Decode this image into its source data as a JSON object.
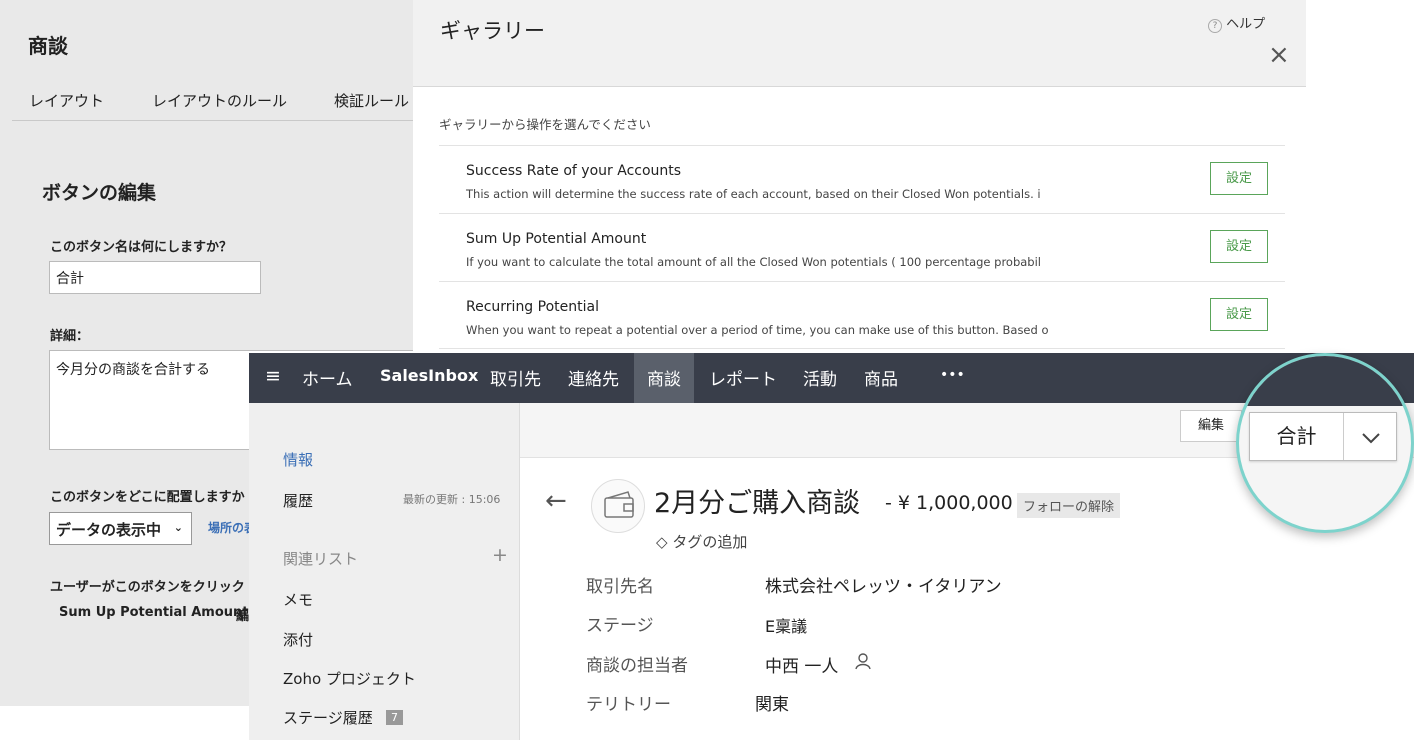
{
  "back_panel": {
    "module_title": "商談",
    "tabs": [
      "レイアウト",
      "レイアウトのルール",
      "検証ルール"
    ],
    "edit_title": "ボタンの編集",
    "name_question": "このボタン名は何にしますか？",
    "name_value": "合計",
    "detail_label": "詳細：",
    "detail_value": "今月分の商談を合計する",
    "place_question": "このボタンをどこに配置しますか",
    "place_value": "データの表示中",
    "place_link": "場所の表",
    "click_question": "ユーザーがこのボタンをクリック",
    "action_value": "Sum Up Potential Amount",
    "action_edit": "編"
  },
  "gallery": {
    "title": "ギャラリー",
    "help": "ヘルプ",
    "close": "×",
    "instruction": "ギャラリーから操作を選んでください",
    "items": [
      {
        "title": "Success Rate of your Accounts",
        "desc": "This action will determine the success rate of each account, based on their Closed Won potentials. i",
        "button": "設定"
      },
      {
        "title": "Sum Up Potential Amount",
        "desc": "If you want to calculate the total amount of all the Closed Won potentials ( 100 percentage probabil",
        "button": "設定"
      },
      {
        "title": "Recurring Potential",
        "desc": "When you want to repeat a potential over a period of time, you can make use of this button. Based o",
        "button": "設定"
      }
    ]
  },
  "nav": {
    "menu_icon": "hamburger-icon",
    "items": [
      "ホーム",
      "SalesInbox",
      "取引先",
      "連絡先",
      "商談",
      "レポート",
      "活動",
      "商品",
      "•••"
    ],
    "active": "商談"
  },
  "sidebar": {
    "info": "情報",
    "history": "履歴",
    "last_update": "最新の更新 : 15:06",
    "related": "関連リスト",
    "add": "+",
    "items": [
      "メモ",
      "添付",
      "Zoho プロジェクト",
      "ステージ履歴"
    ],
    "stage_badge": "7"
  },
  "toolbar": {
    "edit": "編集"
  },
  "record": {
    "back": "←",
    "name": "2月分ご購入商談",
    "amount": "- ¥ 1,000,000",
    "unfollow": "フォローの解除",
    "tag": "タグの追加",
    "fields": [
      {
        "label": "取引先名",
        "value": "株式会社ペレッツ・イタリアン"
      },
      {
        "label": "ステージ",
        "value": "E稟議"
      },
      {
        "label": "商談の担当者",
        "value": "中西 一人"
      },
      {
        "label": "テリトリー",
        "value": "関東"
      }
    ]
  },
  "magnifier": {
    "button": "合計",
    "dropdown": "chevron-down-icon"
  },
  "colors": {
    "nav_bg": "#393e4a",
    "accent_green": "#4a9a4a",
    "link_blue": "#3b6fb6",
    "ring": "#7dd3cc"
  }
}
